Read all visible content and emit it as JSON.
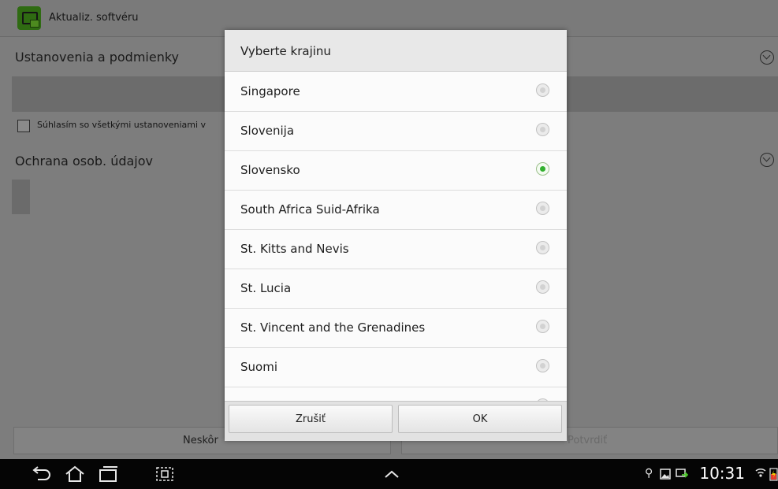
{
  "app": {
    "title": "Aktualiz. softvéru",
    "section_terms": "Ustanovenia a podmienky",
    "agree_label": "Súhlasím so všetkými ustanoveniami v",
    "section_privacy": "Ochrana osob. údajov",
    "later_button": "Neskôr",
    "confirm_button": "Potvrdiť"
  },
  "dialog": {
    "title": "Vyberte krajinu",
    "items": [
      {
        "label": "Singapore",
        "selected": false
      },
      {
        "label": "Slovenija",
        "selected": false
      },
      {
        "label": "Slovensko",
        "selected": true
      },
      {
        "label": "South Africa Suid-Afrika",
        "selected": false
      },
      {
        "label": "St. Kitts and Nevis",
        "selected": false
      },
      {
        "label": "St. Lucia",
        "selected": false
      },
      {
        "label": "St. Vincent and the Grenadines",
        "selected": false
      },
      {
        "label": "Suomi",
        "selected": false
      }
    ],
    "cancel_label": "Zrušiť",
    "ok_label": "OK"
  },
  "status": {
    "time": "10:31",
    "icons": [
      "usb-icon",
      "image-icon",
      "screen-share-icon",
      "wifi-icon",
      "battery-icon"
    ]
  },
  "colors": {
    "selected_radio": "#32b02f",
    "app_icon": "#2f6b12"
  }
}
